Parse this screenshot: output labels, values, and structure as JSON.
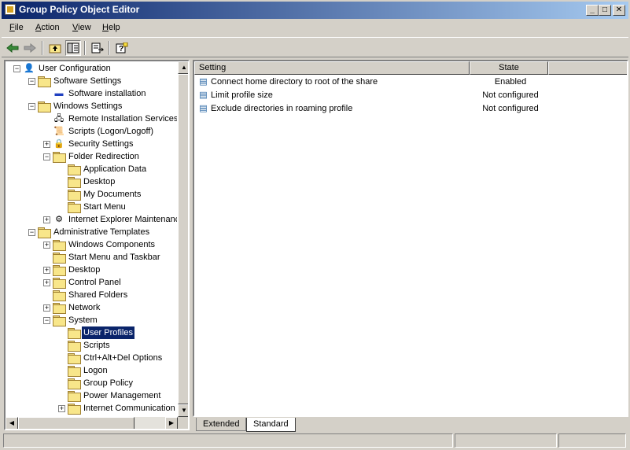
{
  "window": {
    "title": "Group Policy Object Editor",
    "minimize": "_",
    "maximize": "□",
    "close": "✕"
  },
  "menus": [
    {
      "label": "File",
      "key": "F",
      "rest": "ile"
    },
    {
      "label": "Action",
      "key": "A",
      "rest": "ction"
    },
    {
      "label": "View",
      "key": "V",
      "rest": "iew"
    },
    {
      "label": "Help",
      "key": "H",
      "rest": "elp"
    }
  ],
  "toolbar": {
    "back": "back-arrow-icon",
    "forward": "forward-arrow-icon",
    "up": "up-folder-icon",
    "show_tree": "show-hide-tree-icon",
    "export": "export-list-icon",
    "help": "help-icon"
  },
  "tree": {
    "items": [
      {
        "label": "User Configuration",
        "level": 0,
        "expander": "-",
        "icon": "user-config-icon"
      },
      {
        "label": "Software Settings",
        "level": 1,
        "expander": "-",
        "icon": "folder-icon"
      },
      {
        "label": "Software installation",
        "level": 2,
        "expander": "",
        "icon": "software-install-icon"
      },
      {
        "label": "Windows Settings",
        "level": 1,
        "expander": "-",
        "icon": "folder-icon"
      },
      {
        "label": "Remote Installation Services",
        "level": 2,
        "expander": "",
        "icon": "remote-install-icon"
      },
      {
        "label": "Scripts (Logon/Logoff)",
        "level": 2,
        "expander": "",
        "icon": "scripts-icon"
      },
      {
        "label": "Security Settings",
        "level": 2,
        "expander": "+",
        "icon": "security-icon"
      },
      {
        "label": "Folder Redirection",
        "level": 2,
        "expander": "-",
        "icon": "folder-icon"
      },
      {
        "label": "Application Data",
        "level": 3,
        "expander": "",
        "icon": "folder-icon"
      },
      {
        "label": "Desktop",
        "level": 3,
        "expander": "",
        "icon": "folder-icon"
      },
      {
        "label": "My Documents",
        "level": 3,
        "expander": "",
        "icon": "folder-icon"
      },
      {
        "label": "Start Menu",
        "level": 3,
        "expander": "",
        "icon": "folder-icon"
      },
      {
        "label": "Internet Explorer Maintenance",
        "level": 2,
        "expander": "+",
        "icon": "ie-maintenance-icon"
      },
      {
        "label": "Administrative Templates",
        "level": 1,
        "expander": "-",
        "icon": "folder-icon"
      },
      {
        "label": "Windows Components",
        "level": 2,
        "expander": "+",
        "icon": "folder-icon"
      },
      {
        "label": "Start Menu and Taskbar",
        "level": 2,
        "expander": "",
        "icon": "folder-icon"
      },
      {
        "label": "Desktop",
        "level": 2,
        "expander": "+",
        "icon": "folder-icon"
      },
      {
        "label": "Control Panel",
        "level": 2,
        "expander": "+",
        "icon": "folder-icon"
      },
      {
        "label": "Shared Folders",
        "level": 2,
        "expander": "",
        "icon": "folder-icon"
      },
      {
        "label": "Network",
        "level": 2,
        "expander": "+",
        "icon": "folder-icon"
      },
      {
        "label": "System",
        "level": 2,
        "expander": "-",
        "icon": "folder-icon"
      },
      {
        "label": "User Profiles",
        "level": 3,
        "expander": "",
        "icon": "open-folder-icon",
        "selected": true
      },
      {
        "label": "Scripts",
        "level": 3,
        "expander": "",
        "icon": "folder-icon"
      },
      {
        "label": "Ctrl+Alt+Del Options",
        "level": 3,
        "expander": "",
        "icon": "folder-icon"
      },
      {
        "label": "Logon",
        "level": 3,
        "expander": "",
        "icon": "folder-icon"
      },
      {
        "label": "Group Policy",
        "level": 3,
        "expander": "",
        "icon": "folder-icon"
      },
      {
        "label": "Power Management",
        "level": 3,
        "expander": "",
        "icon": "folder-icon"
      },
      {
        "label": "Internet Communication Management",
        "level": 3,
        "expander": "+",
        "icon": "folder-icon"
      }
    ]
  },
  "list": {
    "columns": [
      "Setting",
      "State"
    ],
    "rows": [
      {
        "setting": "Connect home directory to root of the share",
        "state": "Enabled"
      },
      {
        "setting": "Limit profile size",
        "state": "Not configured"
      },
      {
        "setting": "Exclude directories in roaming profile",
        "state": "Not configured"
      }
    ]
  },
  "tabs": [
    {
      "label": "Extended"
    },
    {
      "label": "Standard",
      "active": true
    }
  ],
  "colors": {
    "titlebar_start": "#0a246a",
    "titlebar_end": "#a6caf0",
    "selection": "#0a246a",
    "face": "#d4d0c8"
  }
}
